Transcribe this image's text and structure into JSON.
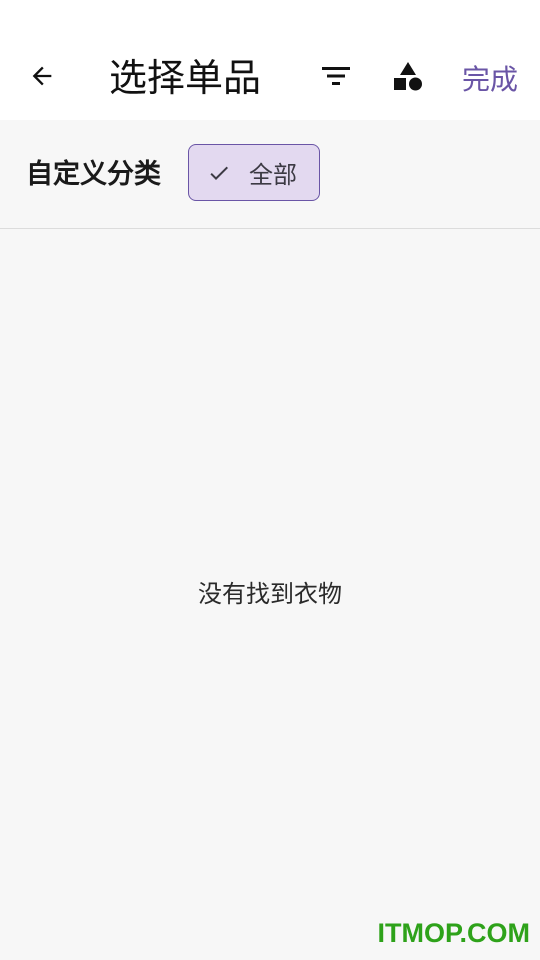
{
  "appbar": {
    "title": "选择单品",
    "back_icon": "arrow-left-icon",
    "filter_icon": "filter-lines-icon",
    "category_icon": "shapes-icon",
    "done_label": "完成"
  },
  "filter_bar": {
    "label": "自定义分类",
    "chips": [
      {
        "label": "全部",
        "selected": true,
        "icon": "check-icon"
      }
    ]
  },
  "content": {
    "empty_message": "没有找到衣物"
  },
  "watermark": {
    "text": "ITMOP.COM"
  },
  "colors": {
    "accent": "#6a55a6",
    "chip_bg": "#e3d9f0",
    "appbar_bg": "#ffffff",
    "page_bg": "#f7f7f7",
    "watermark": "#2ea21a"
  }
}
